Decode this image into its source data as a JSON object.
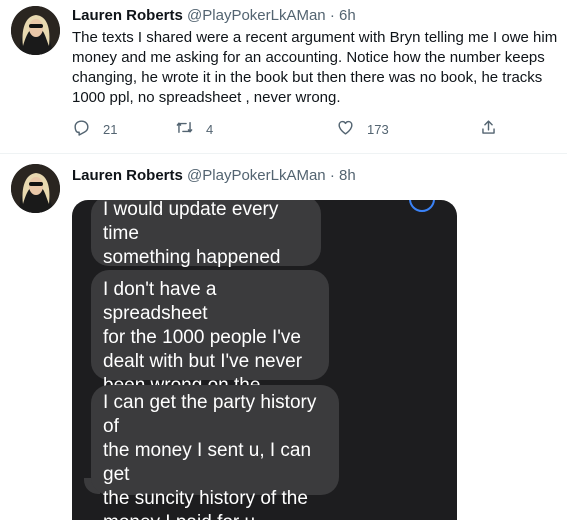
{
  "tweets": [
    {
      "name": "Lauren Roberts",
      "handle": "@PlayPokerLkAMan",
      "separator": "·",
      "time": "6h",
      "text_lines": [
        "The texts I shared were a recent argument with Bryn telling me I owe him",
        "money and me asking for an accounting. Notice how the number keeps",
        "changing, he wrote it in the book but then there was no book, he tracks",
        "1000 ppl, no spreadsheet , never wrong."
      ],
      "replies": "21",
      "retweets": "4",
      "likes": "173",
      "icons": [
        "reply-icon",
        "retweet-icon",
        "like-icon",
        "share-icon"
      ]
    },
    {
      "name": "Lauren Roberts",
      "handle": "@PlayPokerLkAMan",
      "separator": "·",
      "time": "8h",
      "messages": [
        {
          "lines": [
            "I would update every time",
            "something happened"
          ]
        },
        {
          "lines": [
            "I don't have a spreadsheet",
            "for the 1000 people I've",
            "dealt with but I've never",
            "been wrong on the number"
          ]
        },
        {
          "lines": [
            "I can get the party history of",
            "the money I sent u, I can get",
            "the suncity history of the",
            "money I paid for u"
          ]
        }
      ]
    }
  ],
  "colors": {
    "text": "#0f1419",
    "secondary": "#536471",
    "divider": "#eff3f4",
    "bubble": "#3b3b3d",
    "media_bg": "#1d1d1f"
  }
}
